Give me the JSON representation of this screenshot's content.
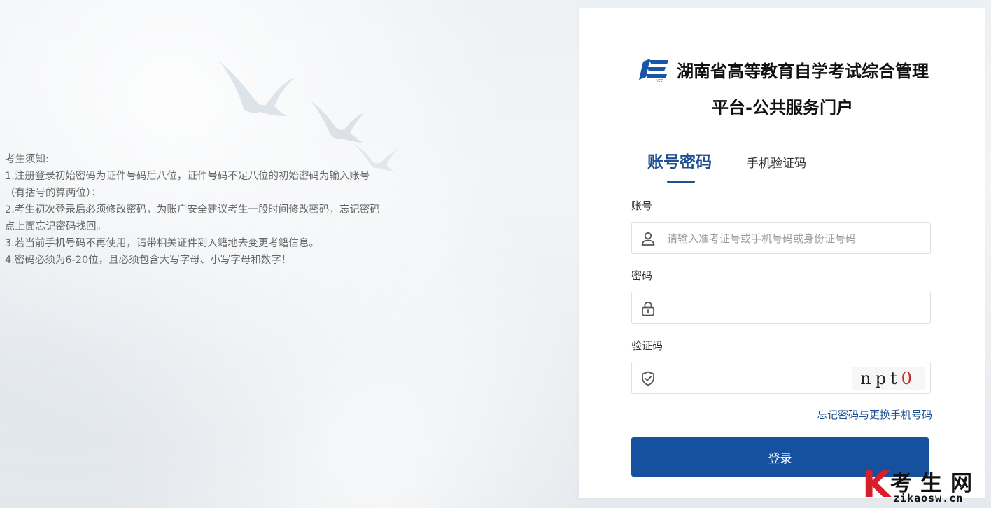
{
  "notice": {
    "heading": "考生须知:",
    "items": [
      "1.注册登录初始密码为证件号码后八位，证件号码不足八位的初始密码为输入账号（有括号的算两位）；",
      "2.考生初次登录后必须修改密码，为账户安全建议考生一段时间修改密码，忘记密码点上面忘记密码找回。",
      "3.若当前手机号码不再使用，请带相关证件到入籍地去变更考籍信息。",
      "4.密码必须为6-20位，且必须包含大写字母、小写字母和数字！"
    ]
  },
  "header": {
    "logo_icon": "hnee-logo",
    "title_line1": "湖南省高等教育自学考试综合管理",
    "title_line2": "平台-公共服务门户"
  },
  "tabs": [
    {
      "label": "账号密码",
      "active": true
    },
    {
      "label": "手机验证码",
      "active": false
    }
  ],
  "form": {
    "account_label": "账号",
    "account_placeholder": "请输入准考证号或手机号码或身份证号码",
    "account_value": "",
    "account_icon": "user-icon",
    "password_label": "密码",
    "password_value": "",
    "password_icon": "lock-icon",
    "captcha_label": "验证码",
    "captcha_value": "",
    "captcha_icon": "shield-check-icon",
    "captcha_image_text": "npt",
    "captcha_image_last": "0",
    "forgot_link": "忘记密码与更换手机号码",
    "login_button": "登录"
  },
  "colors": {
    "primary": "#15519f",
    "tab_active": "#1d4f91",
    "link": "#1d4f91"
  },
  "watermark": {
    "letter": "K",
    "text": "考生网",
    "url": "zikaosw.cn"
  }
}
